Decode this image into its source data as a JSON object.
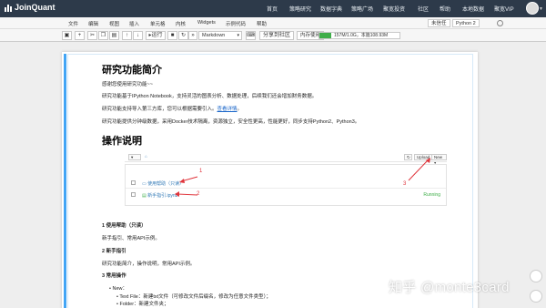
{
  "brand": {
    "name": "JoinQuant"
  },
  "nav": {
    "items": [
      "首页",
      "策略研究",
      "数据字典",
      "策略广场",
      "聚宽投资",
      "社区",
      "帮助",
      "本地数据",
      "聚宽VIP"
    ]
  },
  "menubar": {
    "items": [
      "文件",
      "编辑",
      "视图",
      "插入",
      "单元格",
      "内核",
      "Widgets",
      "示例代码",
      "帮助"
    ],
    "trusted": "未信任",
    "kernel": "Python 2"
  },
  "toolbar": {
    "run_label": "运行",
    "cell_type": "Markdown",
    "share_label": "分享到社区",
    "memory_label": "内存使用",
    "memory_text": "157M/1.0G，本篇108.93M",
    "memory_fraction": 0.15
  },
  "notebook": {
    "h1_intro": "研究功能简介",
    "welcome": "感谢您使用研究功能~~",
    "p1": "研究功能基于IPython Notebook，支持灵活的图表分析、数据处理，后续我们还会增加财务数据。",
    "p2_prefix": "研究功能支持导入第三方库，您可以根据需要引入。",
    "p2_link": "查看详情",
    "p2_suffix": "。",
    "p3": "研究功能提供分钟级数据，采用Docker技术隔离，资源独立，安全性更高，性能更好，同步支持Python2、Python3。",
    "h1_guide": "操作说明",
    "section1": "1 使用帮助（只读）",
    "section1_desc": "新手指引、常用API示例。",
    "section2": "2 新手指引",
    "section2_desc": "研究功能简介，操作说明，常用API示例。",
    "section3": "3 常用操作",
    "bullet_new": "New：",
    "bullet_textfile": "Text File：新建txt文件（可修改文件后缀名，修改为任意文件类型）；",
    "bullet_folder": "Folder：新建文件夹；"
  },
  "screenshot": {
    "upload": "Upload",
    "new": "New ▾",
    "row1": "使用帮助（只读）",
    "row2": "新手指引.ipynb",
    "running": "Running",
    "num1": "1",
    "num2": "2",
    "num3": "3"
  },
  "watermark": "知乎 @monte3card"
}
